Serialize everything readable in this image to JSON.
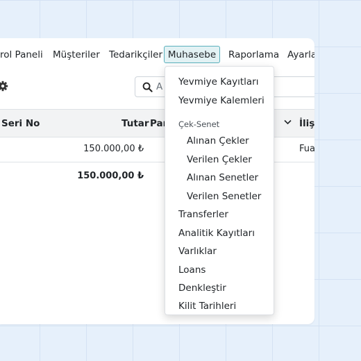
{
  "navbar": {
    "items": [
      "rol Paneli",
      "Müşteriler",
      "Tedarikçiler",
      "Muhasebe",
      "Raporlama",
      "Ayarla"
    ],
    "active": "Muhasebe"
  },
  "control_panel": {
    "settings_icon": "gear-icon",
    "search_icon": "search-icon",
    "search_value": "A"
  },
  "table": {
    "headers": {
      "seri_no": "Seri No",
      "tutar": "Tutar",
      "partner": "Par",
      "iliski": "İlişk"
    },
    "rows": [
      {
        "tutar": "150.000,00 ₺",
        "iliski": "Fua"
      }
    ],
    "total": "150.000,00 ₺"
  },
  "dropdown": {
    "items": [
      {
        "label": "Yevmiye Kayıtları"
      },
      {
        "label": "Yevmiye Kalemleri"
      },
      {
        "section": "Çek-Senet"
      },
      {
        "label": "Alınan Çekler",
        "indent": true
      },
      {
        "label": "Verilen Çekler",
        "indent": true
      },
      {
        "label": "Alınan Senetler",
        "indent": true
      },
      {
        "label": "Verilen Senetler",
        "indent": true
      },
      {
        "label": "Transferler"
      },
      {
        "label": "Analitik Kayıtları"
      },
      {
        "label": "Varlıklar"
      },
      {
        "label": "Loans"
      },
      {
        "label": "Denkleştir"
      },
      {
        "label": "Kilit Tarihleri"
      }
    ]
  }
}
